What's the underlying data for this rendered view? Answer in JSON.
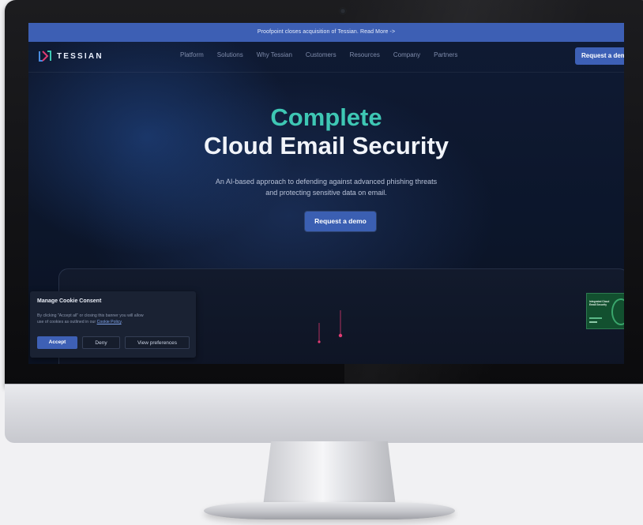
{
  "announcement": {
    "text": "Proofpoint closes acquisition of Tessian. Read More ->"
  },
  "brand": {
    "name": "TESSIAN",
    "logo_icon": "tessian-logo-icon"
  },
  "nav": {
    "links": [
      {
        "label": "Platform"
      },
      {
        "label": "Solutions"
      },
      {
        "label": "Why Tessian"
      },
      {
        "label": "Customers"
      },
      {
        "label": "Resources"
      },
      {
        "label": "Company"
      },
      {
        "label": "Partners"
      }
    ],
    "cta_label": "Request a demo"
  },
  "hero": {
    "headline_line1": "Complete",
    "headline_line2": "Cloud Email Security",
    "subtitle_line1": "An AI-based approach to defending against advanced phishing threats",
    "subtitle_line2": "and protecting sensitive data on email.",
    "cta_label": "Request a demo"
  },
  "thumbnail": {
    "title": "Integrated Cloud Email Security"
  },
  "cookie_banner": {
    "title": "Manage Cookie Consent",
    "text_line1": "By clicking \"Accept all\" or closing this banner you will allow",
    "text_line2_prefix": "use of cookies as outlined in our",
    "link_text": "Cookie Policy",
    "text_line2_suffix": ".",
    "accept_label": "Accept",
    "deny_label": "Deny",
    "preferences_label": "View preferences"
  },
  "colors": {
    "accent": "#3d60b6",
    "headline_teal": "#3ec7b4",
    "background": "#0c1424"
  }
}
